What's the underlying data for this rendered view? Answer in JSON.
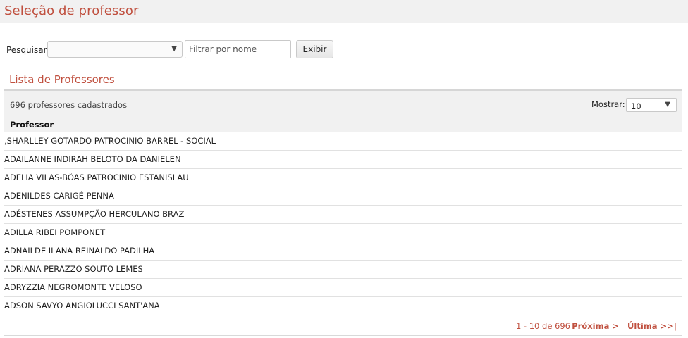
{
  "header": {
    "title": "Seleção de professor"
  },
  "search": {
    "label": "Pesquisar:",
    "select_value": "",
    "filter_placeholder": "Filtrar por nome",
    "filter_value": "",
    "button_label": "Exibir"
  },
  "list": {
    "title": "Lista de Professores",
    "count_text": "696 professores cadastrados",
    "show_label": "Mostrar:",
    "page_size": "10",
    "column_header": "Professor",
    "rows": [
      ",SHARLLEY GOTARDO PATROCINIO BARREL - SOCIAL",
      "ADAILANNE INDIRAH BELOTO DA DANIELEN",
      "ADELIA VILAS-BÔAS PATROCINIO ESTANISLAU",
      "ADENILDES CARIGÉ PENNA",
      "ADÉSTENES ASSUMPÇÃO HERCULANO BRAZ",
      "ADILLA RIBEI POMPONET",
      "ADNAILDE ILANA REINALDO PADILHA",
      "ADRIANA PERAZZO SOUTO LEMES",
      "ADRYZZIA NEGROMONTE VELOSO",
      "ADSON SAVYO ANGIOLUCCI SANT'ANA"
    ]
  },
  "pagination": {
    "range": "1 - 10 de 696",
    "next_label": "Próxima >",
    "last_label": "Última >>|"
  },
  "icons": {
    "dropdown": "chevron-down-icon"
  },
  "colors": {
    "accent": "#c0503f",
    "panel_bg": "#f1f1f1"
  }
}
